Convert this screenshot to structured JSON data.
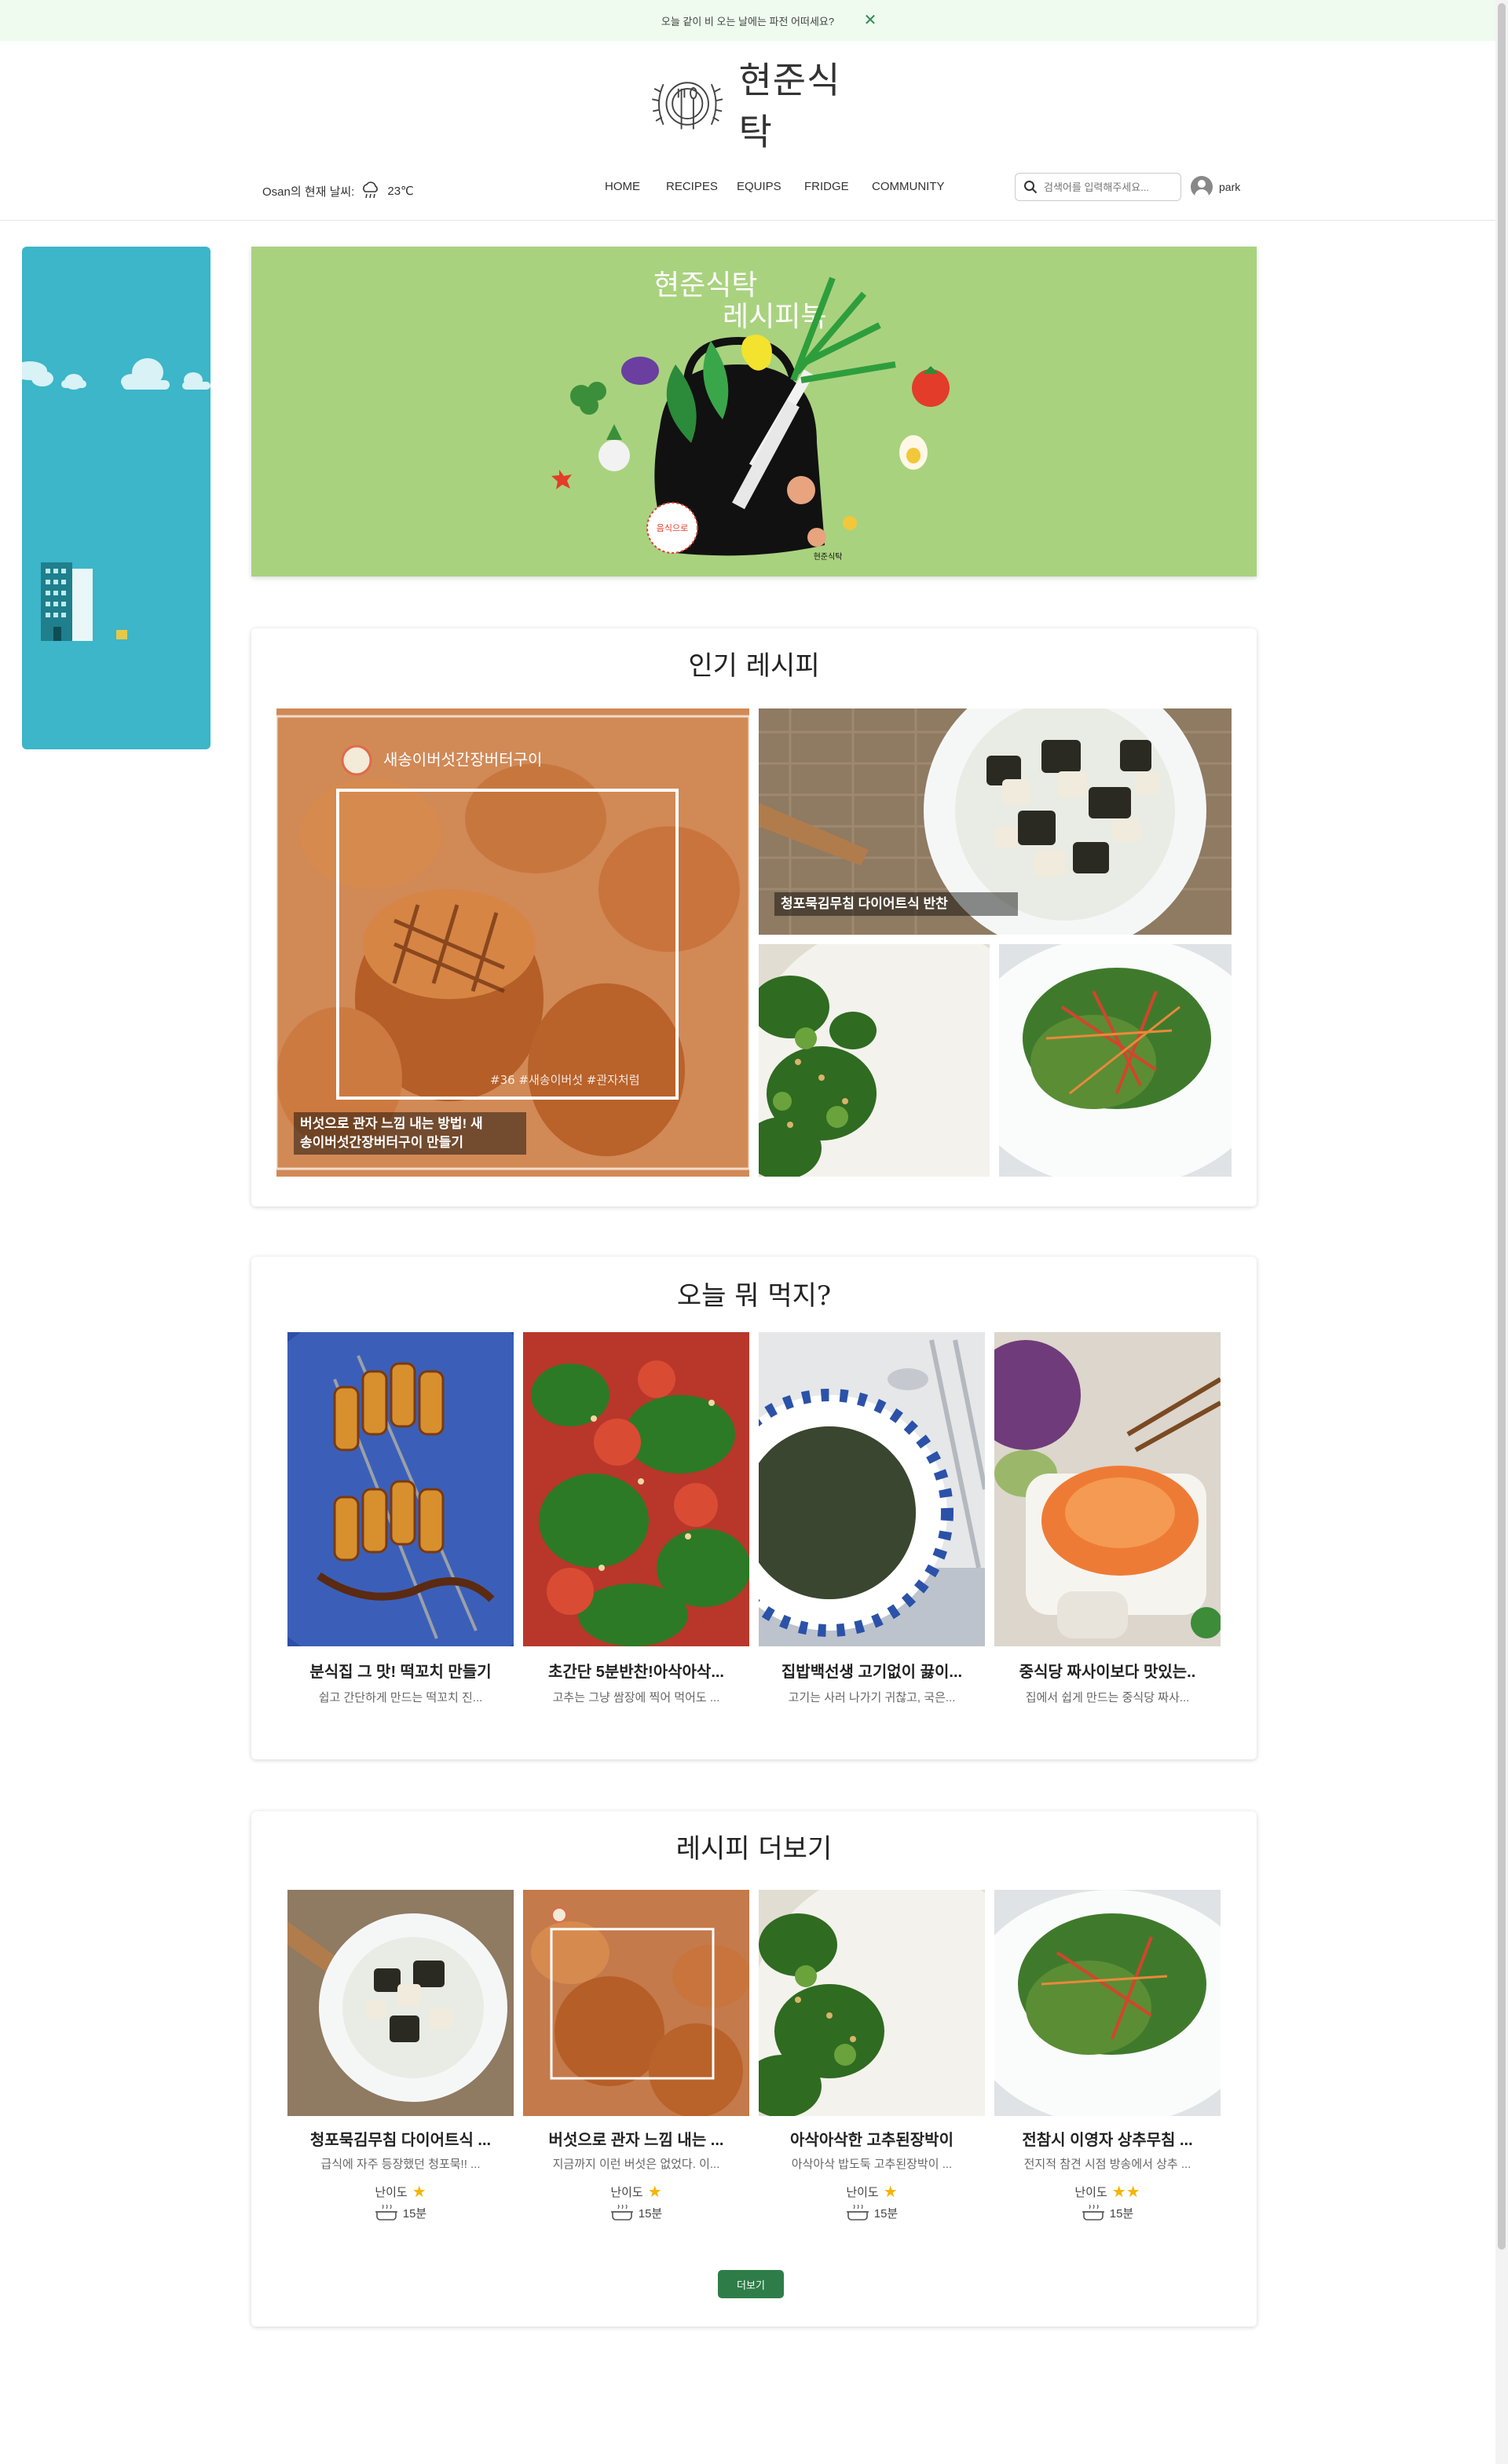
{
  "notice": {
    "text": "오늘 같이 비 오는 날에는 파전 어떠세요?",
    "close_label": "✕"
  },
  "header": {
    "logo_text": "현준식탁",
    "weather": {
      "location_label": "Osan의 현재 날씨:",
      "temperature": "23℃",
      "condition_icon": "rain-cloud-icon"
    },
    "nav": [
      "HOME",
      "RECIPES",
      "EQUIPS",
      "FRIDGE",
      "COMMUNITY"
    ],
    "search": {
      "placeholder": "검색어를 입력해주세요..."
    },
    "user": {
      "name": "park"
    }
  },
  "hero": {
    "line1": "현준식탁",
    "line2": "레시피북",
    "badge": "음식으로",
    "brand": "현준식탁"
  },
  "popular": {
    "title": "인기 레시피",
    "featured": {
      "caption": "버섯으로 관자 느낌 내는 방법! 새\n송이버섯간장버터구이 만들기",
      "overlay_title": "새송이버섯간장버터구이",
      "overlay_tags": "#36 #새송이버섯 #관자처럼"
    },
    "top_right": {
      "caption": "청포묵김무침 다이어트식 반찬"
    }
  },
  "today": {
    "title": "오늘 뭐 먹지?",
    "items": [
      {
        "title": "분식집 그 맛! 떡꼬치 만들기",
        "desc": "쉽고 간단하게 만드는 떡꼬치 진..."
      },
      {
        "title": "초간단 5분반찬!아삭아삭...",
        "desc": "고추는 그냥 쌈장에 찍어 먹어도 ..."
      },
      {
        "title": "집밥백선생 고기없이 끓이...",
        "desc": "고기는 사러 나가기 귀찮고, 국은..."
      },
      {
        "title": "중식당 짜사이보다 맛있는..",
        "desc": "집에서 쉽게 만드는 중식당 짜사..."
      }
    ]
  },
  "more": {
    "title": "레시피 더보기",
    "difficulty_label": "난이도",
    "items": [
      {
        "title": "청포묵김무침 다이어트식 ...",
        "desc": "급식에 자주 등장했던 청포묵!! ...",
        "stars": 1,
        "time": "15분"
      },
      {
        "title": "버섯으로 관자 느낌 내는 ...",
        "desc": "지금까지 이런 버섯은 없었다. 이...",
        "stars": 1,
        "time": "15분"
      },
      {
        "title": "아삭아삭한 고추된장박이",
        "desc": "아삭아삭 밥도둑 고추된장박이 ...",
        "stars": 1,
        "time": "15분"
      },
      {
        "title": "전참시 이영자 상추무침 ...",
        "desc": "전지적 참견 시점 방송에서 상추 ...",
        "stars": 2,
        "time": "15분"
      }
    ],
    "button_label": "더보기"
  },
  "colors": {
    "accent": "#2e7d48",
    "hero_bg": "#a9d27f",
    "side_banner": "#3cb6c8",
    "notice_bg": "#eefbee"
  }
}
